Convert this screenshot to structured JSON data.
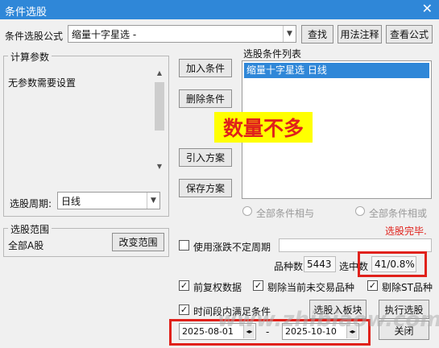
{
  "window": {
    "title": "条件选股",
    "close_glyph": "✕"
  },
  "formula": {
    "label": "条件选股公式",
    "selected": "缩量十字星选  -",
    "find_btn": "查找",
    "usage_btn": "用法注释",
    "view_btn": "查看公式"
  },
  "params": {
    "group_title": "计算参数",
    "text": "无参数需要设置",
    "period_label": "选股周期:",
    "period_value": "日线"
  },
  "actions": {
    "add": "加入条件",
    "remove": "删除条件",
    "import": "引入方案",
    "save": "保存方案"
  },
  "conditions": {
    "title": "选股条件列表",
    "items": [
      "缩量十字星选  日线"
    ],
    "overlay": "数量不多",
    "radio_and": "全部条件相与",
    "radio_or": "全部条件相或"
  },
  "status": {
    "text": "选股完毕.",
    "color": "#e0211b"
  },
  "range": {
    "group_title": "选股范围",
    "value": "全部A股",
    "change_btn": "改变范围"
  },
  "options": {
    "irregular_label": "使用涨跌不定周期",
    "count_label": "品种数",
    "count_value": "5443",
    "selected_label": "选中数",
    "selected_value": "41/0.8%",
    "fq_label": "前复权数据",
    "exclude_untraded": "剔除当前未交易品种",
    "exclude_st": "剔除ST品种",
    "period_satisfy": "时间段内满足条件"
  },
  "bottom": {
    "add_to_sector": "选股入板块",
    "run": "执行选股",
    "close": "关闭",
    "date_from": "2025-08-01",
    "date_sep": "-",
    "date_to": "2025-10-10"
  },
  "watermark": "www.zhibiaow.com",
  "colors": {
    "titlebar": "#2f87d8",
    "selection": "#2f87d8",
    "highlight": "#e0211b",
    "overlay_bg": "#ffff00"
  }
}
